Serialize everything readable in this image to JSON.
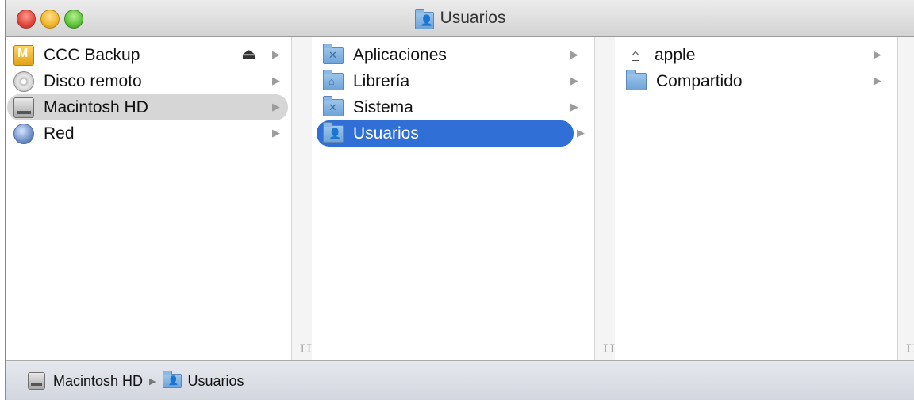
{
  "window": {
    "title": "Usuarios",
    "title_icon": "users-folder-icon"
  },
  "columns": {
    "col1": {
      "items": [
        {
          "label": "CCC Backup",
          "icon": "backup-drive-icon",
          "eject": "⏏",
          "arrow": "▶"
        },
        {
          "label": "Disco remoto",
          "icon": "disc-icon",
          "arrow": "▶"
        },
        {
          "label": "Macintosh HD",
          "icon": "hard-drive-icon",
          "arrow": "▶",
          "selected": "gray"
        },
        {
          "label": "Red",
          "icon": "network-icon",
          "arrow": "▶"
        }
      ]
    },
    "col2": {
      "items": [
        {
          "label": "Aplicaciones",
          "icon": "applications-folder-icon",
          "arrow": "▶"
        },
        {
          "label": "Librería",
          "icon": "library-folder-icon",
          "arrow": "▶"
        },
        {
          "label": "Sistema",
          "icon": "system-folder-icon",
          "arrow": "▶"
        },
        {
          "label": "Usuarios",
          "icon": "users-folder-icon",
          "arrow": "▶",
          "selected": "blue"
        }
      ]
    },
    "col3": {
      "items": [
        {
          "label": "apple",
          "icon": "home-icon",
          "arrow": "▶"
        },
        {
          "label": "Compartido",
          "icon": "folder-icon",
          "arrow": "▶"
        }
      ]
    },
    "grip": "II"
  },
  "pathbar": {
    "items": [
      {
        "label": "Macintosh HD",
        "icon": "hard-drive-icon"
      },
      {
        "label": "Usuarios",
        "icon": "users-folder-icon"
      }
    ],
    "separator": "▶"
  },
  "colors": {
    "selection_blue": "#2f6fd6",
    "selection_gray": "#d6d6d6"
  }
}
